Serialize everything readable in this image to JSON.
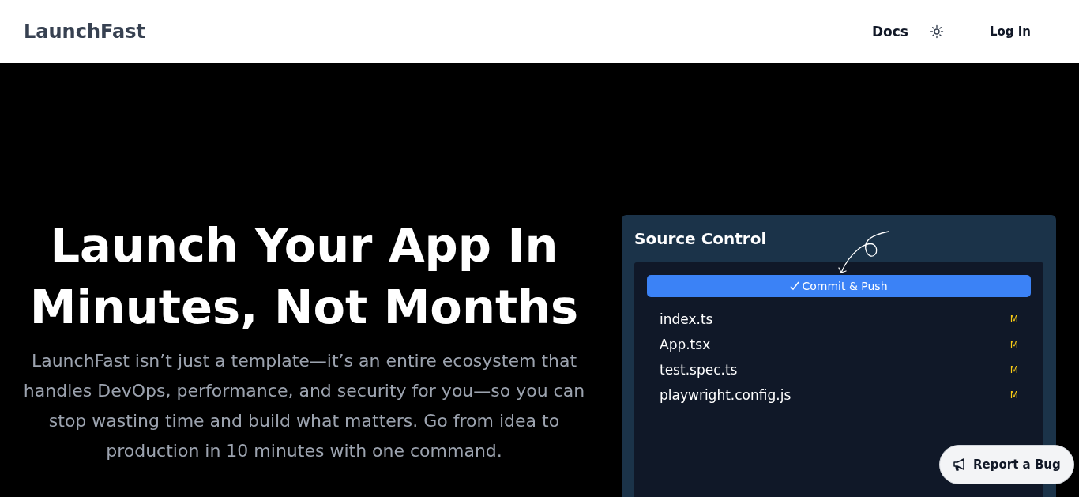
{
  "header": {
    "logo": "LaunchFast",
    "nav": [
      {
        "label": "Docs"
      }
    ],
    "login": "Log In"
  },
  "hero": {
    "title": "Launch Your App In Minutes, Not Months",
    "description": "LaunchFast isn’t just a template—it’s an entire ecosystem that handles DevOps, performance, and security for you—so you can stop wasting time and build what matters. Go from idea to production in 10 minutes with one command."
  },
  "source_control": {
    "title": "Source Control",
    "commit_button": "Commit & Push",
    "files": [
      {
        "name": "index.ts",
        "status": "M"
      },
      {
        "name": "App.tsx",
        "status": "M"
      },
      {
        "name": "test.spec.ts",
        "status": "M"
      },
      {
        "name": "playwright.config.js",
        "status": "M"
      }
    ]
  },
  "report_button": "Report a Bug"
}
